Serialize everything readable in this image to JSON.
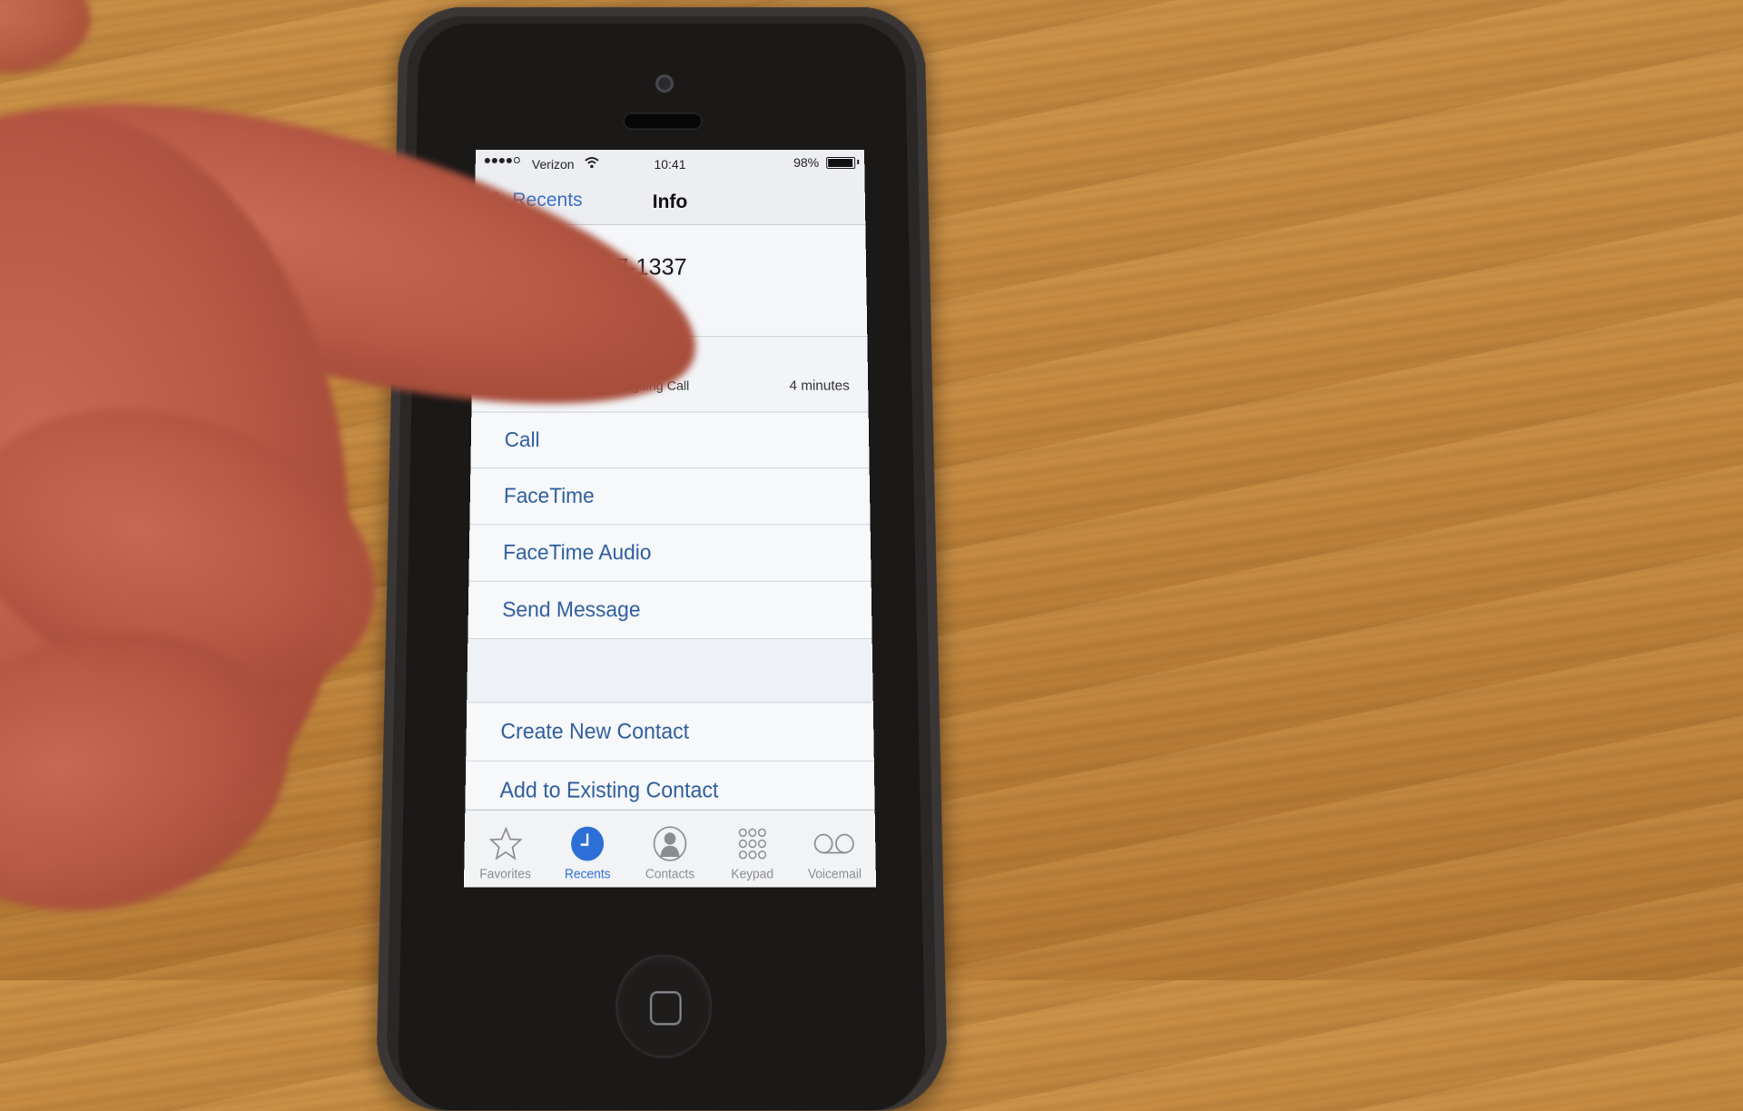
{
  "status_bar": {
    "signal_bars_filled": 4,
    "signal_bars_total": 5,
    "carrier": "Verizon",
    "time": "10:41",
    "battery_percent_label": "98%",
    "battery_level": 0.98
  },
  "nav_bar": {
    "back_label": "Recents",
    "title": "Info"
  },
  "header": {
    "phone_number": "+1 (855) 567-1337"
  },
  "recent_call": {
    "type_label": "Outgoing Call",
    "duration": "4 minutes"
  },
  "actions": [
    {
      "label": "Call"
    },
    {
      "label": "FaceTime"
    },
    {
      "label": "FaceTime Audio"
    },
    {
      "label": "Send Message"
    }
  ],
  "contact_actions": [
    {
      "label": "Create New Contact"
    },
    {
      "label": "Add to Existing Contact"
    }
  ],
  "tab_bar": {
    "tabs": [
      {
        "label": "Favorites",
        "icon": "star-icon",
        "active": false
      },
      {
        "label": "Recents",
        "icon": "clock-icon",
        "active": true
      },
      {
        "label": "Contacts",
        "icon": "person-icon",
        "active": false
      },
      {
        "label": "Keypad",
        "icon": "keypad-icon",
        "active": false
      },
      {
        "label": "Voicemail",
        "icon": "voicemail-icon",
        "active": false
      }
    ]
  },
  "colors": {
    "accent": "#2c6fd6",
    "link_text": "#2f5d9c",
    "tab_inactive": "#8a8c92"
  }
}
